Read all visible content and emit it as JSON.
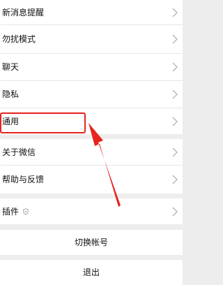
{
  "menu": {
    "items": [
      {
        "label": "新消息提醒"
      },
      {
        "label": "勿扰模式"
      },
      {
        "label": "聊天"
      },
      {
        "label": "隐私"
      },
      {
        "label": "通用"
      },
      {
        "label": "关于微信"
      },
      {
        "label": "帮助与反馈"
      },
      {
        "label": "插件"
      }
    ]
  },
  "actions": {
    "switch_account": "切换帐号",
    "logout": "退出"
  },
  "icons": {
    "chevron": "chevron-right-icon",
    "plugin": "shield-icon"
  },
  "colors": {
    "highlight": "#e8231c",
    "background": "#ededed",
    "row": "#ffffff"
  }
}
